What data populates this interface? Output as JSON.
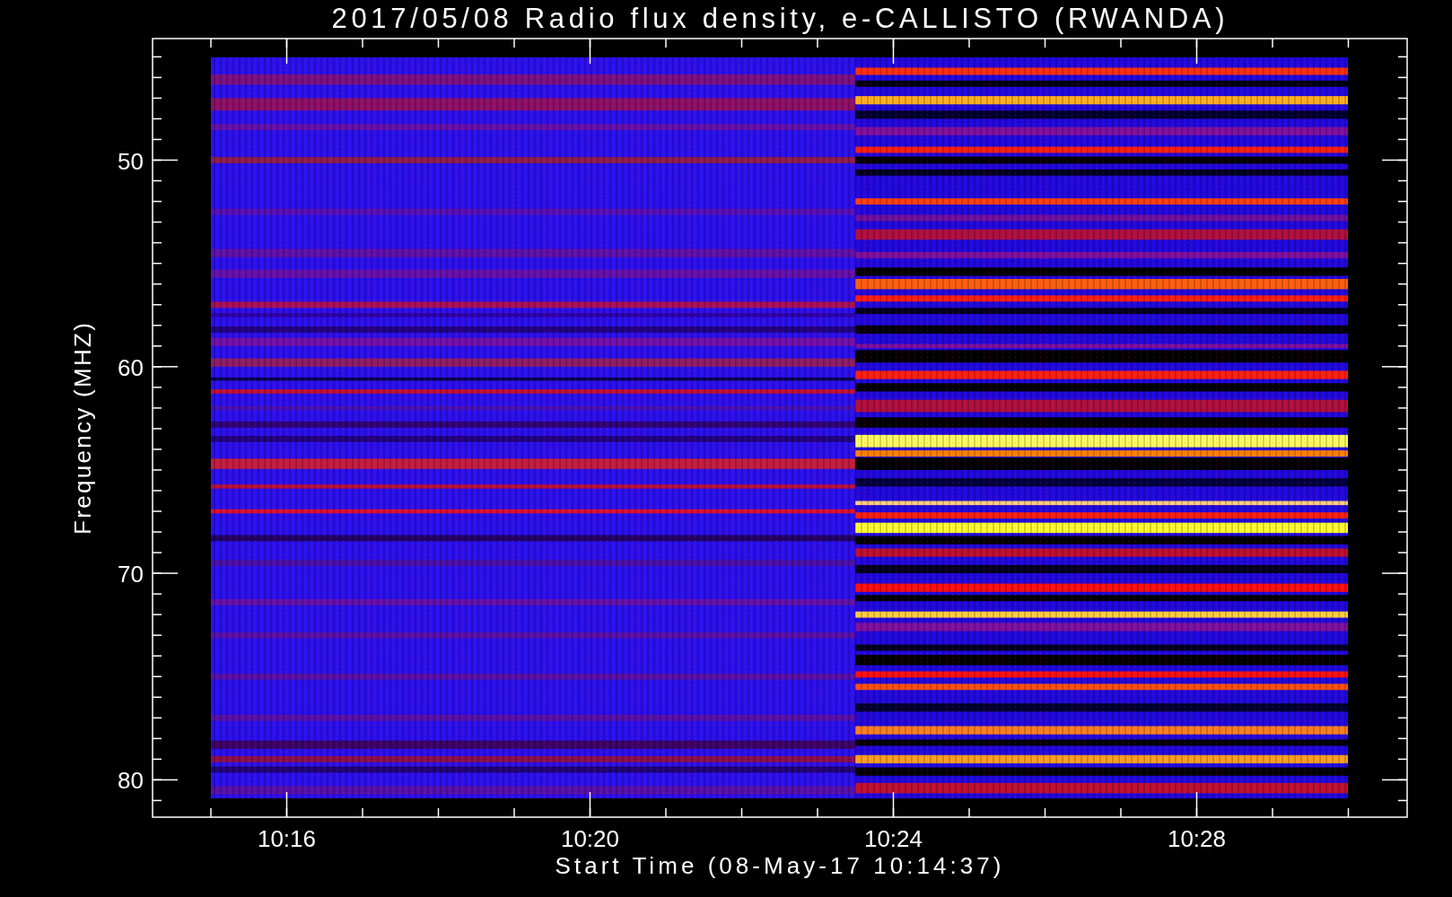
{
  "title": "2017/05/08  Radio flux density, e-CALLISTO (RWANDA)",
  "y_axis": {
    "label": "Frequency (MHZ)",
    "tick_labels": [
      "50",
      "60",
      "70",
      "80"
    ]
  },
  "x_axis": {
    "label": "Start Time (08-May-17 10:14:37)",
    "tick_labels": [
      "10:16",
      "10:20",
      "10:24",
      "10:28"
    ]
  }
}
